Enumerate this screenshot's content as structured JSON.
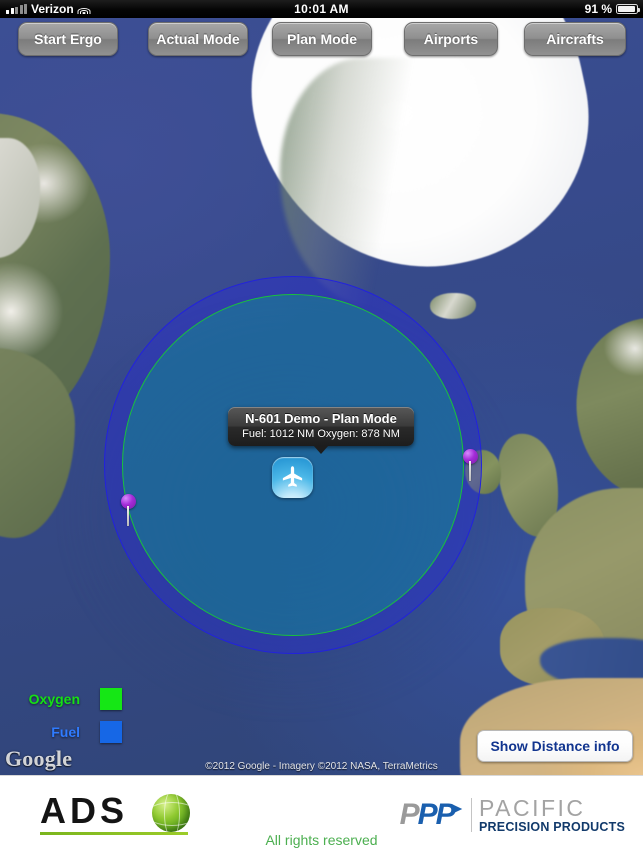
{
  "status_bar": {
    "carrier": "Verizon",
    "signal_icon": "signal-bars-icon",
    "wifi_icon": "wifi-icon",
    "time": "10:01 AM",
    "battery_percent": "91 %",
    "battery_icon": "battery-icon",
    "battery_level": 91
  },
  "toolbar": {
    "buttons": [
      {
        "id": "start-ergo",
        "label": "Start Ergo"
      },
      {
        "id": "actual-mode",
        "label": "Actual Mode"
      },
      {
        "id": "plan-mode",
        "label": "Plan Mode"
      },
      {
        "id": "airports",
        "label": "Airports"
      },
      {
        "id": "aircrafts",
        "label": "Aircrafts"
      }
    ]
  },
  "map": {
    "callout": {
      "title": "N-601 Demo - Plan Mode",
      "subtitle": "Fuel: 1012 NM Oxygen: 878 NM",
      "fuel_nm": 1012,
      "oxygen_nm": 878
    },
    "aircraft_marker_icon": "airplane-icon",
    "pins": [
      {
        "id": "pin-west",
        "icon": "map-pin-icon"
      },
      {
        "id": "pin-east",
        "icon": "map-pin-icon"
      }
    ],
    "range_rings": [
      {
        "id": "fuel-ring",
        "label": "Fuel",
        "color": "#2222dd",
        "radius_nm": 1012
      },
      {
        "id": "oxygen-ring",
        "label": "Oxygen",
        "color": "#19c23c",
        "radius_nm": 878
      }
    ],
    "legend": {
      "oxygen_label": "Oxygen",
      "oxygen_color": "#15e715",
      "fuel_label": "Fuel",
      "fuel_color": "#1667e6"
    },
    "google_watermark": "Google",
    "attribution": "©2012 Google - Imagery ©2012 NASA, TerraMetrics",
    "show_distance_button": "Show Distance info"
  },
  "footer": {
    "ads_logo_text": "ADS",
    "ads_logo_icon": "green-globe-icon",
    "rights_text": "All rights reserved",
    "ppp": {
      "mark_gray": "P",
      "mark_blue": "PP",
      "arrow_icon": "arrow-right-icon",
      "pacific": "PACIFIC",
      "precision": "PRECISION PRODUCTS"
    }
  }
}
